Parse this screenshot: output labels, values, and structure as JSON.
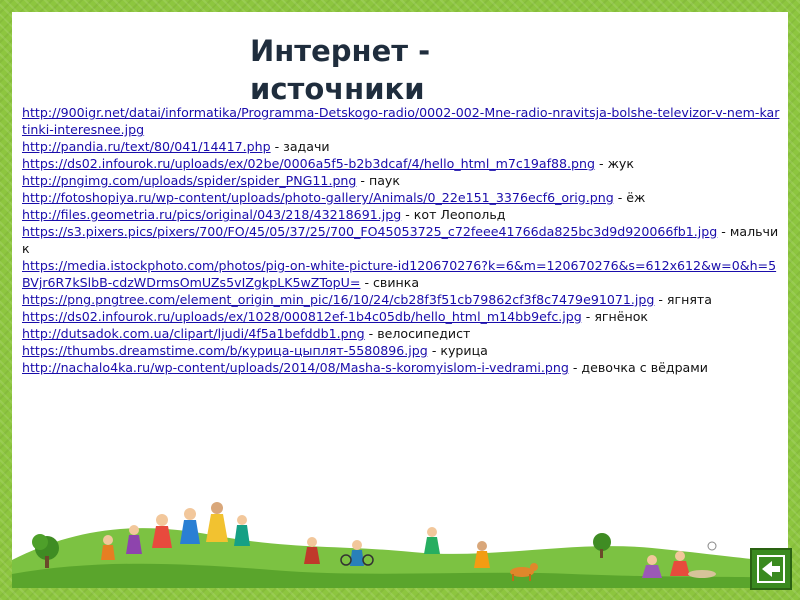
{
  "slide": {
    "title_line1": "Интернет -",
    "title_line2": "источники"
  },
  "references": [
    {
      "url": "http://900igr.net/datai/informatika/Programma-Detskogo-radio/0002-002-Mne-radio-nravitsja-bolshe-televizor-v-nem-kartinki-interesnee.jpg",
      "desc": ""
    },
    {
      "url": "http://pandia.ru/text/80/041/14417.php",
      "desc": " - задачи"
    },
    {
      "url": "https://ds02.infourok.ru/uploads/ex/02be/0006a5f5-b2b3dcaf/4/hello_html_m7c19af88.png",
      "desc": " - жук"
    },
    {
      "url": "http://pngimg.com/uploads/spider/spider_PNG11.png",
      "desc": " - паук"
    },
    {
      "url": "http://fotoshopiya.ru/wp-content/uploads/photo-gallery/Animals/0_22e151_3376ecf6_orig.png",
      "desc": " - ёж"
    },
    {
      "url": "http://files.geometria.ru/pics/original/043/218/43218691.jpg",
      "desc": " - кот Леопольд"
    },
    {
      "url": "https://s3.pixers.pics/pixers/700/FO/45/05/37/25/700_FO45053725_c72feee41766da825bc3d9d920066fb1.jpg",
      "desc": " - мальчик"
    },
    {
      "url": "https://media.istockphoto.com/photos/pig-on-white-picture-id120670276?k=6&m=120670276&s=612x612&w=0&h=5BVjr6R7kSlbB-cdzWDrmsOmUZs5vIZgkpLK5wZTopU=",
      "desc": " - свинка"
    },
    {
      "url": "https://png.pngtree.com/element_origin_min_pic/16/10/24/cb28f3f51cb79862cf3f8c7479e91071.jpg",
      "desc": " - ягнята"
    },
    {
      "url": "https://ds02.infourok.ru/uploads/ex/1028/000812ef-1b4c05db/hello_html_m14bb9efc.jpg",
      "desc": " - ягнёнок"
    },
    {
      "url": "http://dutsadok.com.ua/clipart/ljudi/4f5a1befddb1.png",
      "desc": " - велосипедист"
    },
    {
      "url": "https://thumbs.dreamstime.com/b/курица-цыплят-5580896.jpg",
      "desc": " - курица"
    },
    {
      "url": "http://nachalo4ka.ru/wp-content/uploads/2014/08/Masha-s-koromyislom-i-vedrami.png",
      "desc": " - девочка с вёдрами"
    }
  ],
  "nav": {
    "icon": "back-arrow-icon"
  },
  "colors": {
    "frame": "#8dc63f",
    "link": "#1a0dab",
    "title": "#1f2d3d",
    "nav": "#3a8a1f"
  }
}
